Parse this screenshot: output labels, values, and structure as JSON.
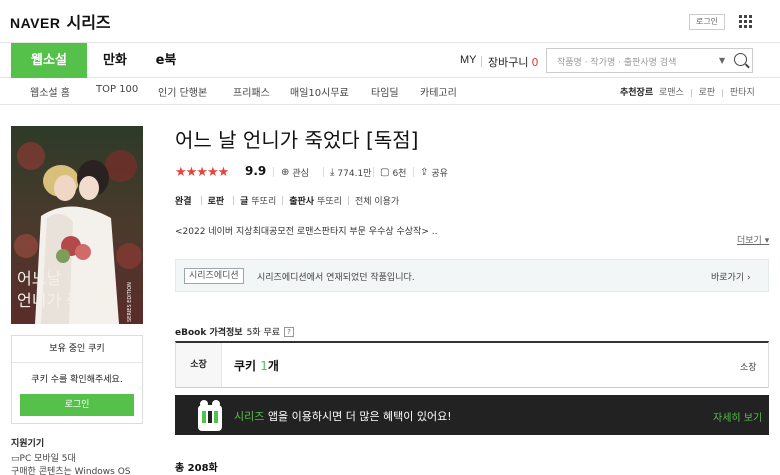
{
  "header": {
    "logo_naver": "NAVER",
    "logo_series": "시리즈",
    "login_label": "로그인",
    "apps_icon": "grid-icon"
  },
  "nav": {
    "tabs": [
      {
        "label": "웹소설",
        "active": true
      },
      {
        "label": "만화",
        "active": false
      },
      {
        "label": "e북",
        "active": false
      }
    ],
    "my_label": "MY",
    "cart_label": "장바구니",
    "cart_count": "0",
    "search_placeholder": "작품명 · 작가명 · 출판사명 검색"
  },
  "subnav": {
    "items": [
      "웹소설 홈",
      "TOP 100",
      "인기 단행본",
      "프리패스",
      "매일10시무료",
      "타임딜",
      "카테고리"
    ],
    "genre_label": "추천장르",
    "genres": [
      "로맨스",
      "로판",
      "판타지"
    ]
  },
  "sidebar": {
    "cookie_header": "보유 중인 쿠키",
    "cookie_msg": "쿠키 수를 확인해주세요.",
    "login_button": "로그인",
    "support_title": "지원기기",
    "support_devices": "PC  모바일 5대",
    "support_os": "구매한 콘텐츠는 Windows OS"
  },
  "cover_text": {
    "title": "언니가 죽었다",
    "edition": "SERIES EDITION"
  },
  "book": {
    "title": "어느 날 언니가 죽었다 [독점]",
    "stars": "★★★★★",
    "rating": "9.9",
    "interest_label": "관심",
    "downloads": "774.1만",
    "comments": "6천",
    "share_label": "공유",
    "meta": {
      "status": "완결",
      "genre": "로판",
      "author_label": "글",
      "author": "뚜또리",
      "publisher_label": "출판사",
      "publisher": "뚜또리",
      "age": "전체 이용가"
    },
    "description": "<2022 네이버 지상최대공모전 로맨스판타지 부문 우수상 수상작> ..",
    "more_label": "더보기",
    "edition_badge": "시리즈에디션",
    "edition_text": "시리즈에디션에서 연재되었던 작품입니다.",
    "edition_link": "바로가기",
    "price_title": "eBook 가격정보",
    "price_free": "5화 무료",
    "own_label": "소장",
    "cookie_prefix": "쿠키",
    "cookie_amount": "1",
    "cookie_unit": "개",
    "own_right": "소장",
    "banner_brand": "시리즈",
    "banner_text": "앱을 이용하시면 더 많은 혜택이 있어요!",
    "banner_more": "자세히 보기",
    "total": "총 208화"
  }
}
